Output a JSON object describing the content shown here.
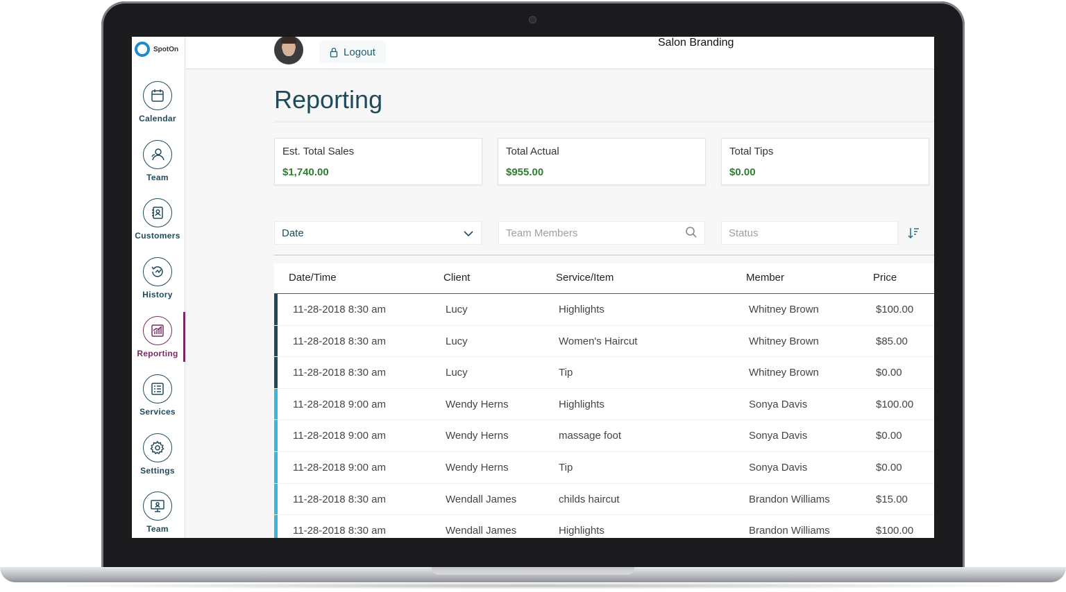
{
  "app": {
    "logo_text": "SpotOn",
    "brand": "Salon Branding",
    "logout_label": "Logout"
  },
  "sidebar": {
    "items": [
      {
        "label": "Calendar",
        "icon": "calendar-icon"
      },
      {
        "label": "Team",
        "icon": "team-icon"
      },
      {
        "label": "Customers",
        "icon": "customers-icon"
      },
      {
        "label": "History",
        "icon": "history-icon"
      },
      {
        "label": "Reporting",
        "icon": "reporting-icon",
        "active": true
      },
      {
        "label": "Services",
        "icon": "services-icon"
      },
      {
        "label": "Settings",
        "icon": "gear-icon"
      },
      {
        "label": "Team",
        "icon": "monitor-icon"
      }
    ]
  },
  "page": {
    "title": "Reporting"
  },
  "cards": [
    {
      "label": "Est. Total Sales",
      "value": "$1,740.00"
    },
    {
      "label": "Total Actual",
      "value": "$955.00"
    },
    {
      "label": "Total Tips",
      "value": "$0.00"
    }
  ],
  "filters": {
    "date_value": "Date",
    "team_placeholder": "Team Members",
    "status_placeholder": "Status"
  },
  "table": {
    "columns": [
      "Date/Time",
      "Client",
      "Service/Item",
      "Member",
      "Price"
    ],
    "rows": [
      {
        "datetime": "11-28-2018 8:30 am",
        "client": "Lucy",
        "service": "Highlights",
        "member": "Whitney Brown",
        "price": "$100.00",
        "accent": "#1f4a5a"
      },
      {
        "datetime": "11-28-2018 8:30 am",
        "client": "Lucy",
        "service": "Women's Haircut",
        "member": "Whitney Brown",
        "price": "$85.00",
        "accent": "#1f4a5a"
      },
      {
        "datetime": "11-28-2018 8:30 am",
        "client": "Lucy",
        "service": "Tip",
        "member": "Whitney Brown",
        "price": "$0.00",
        "accent": "#1f4a5a"
      },
      {
        "datetime": "11-28-2018 9:00 am",
        "client": "Wendy Herns",
        "service": "Highlights",
        "member": "Sonya Davis",
        "price": "$100.00",
        "accent": "#3bb8d8"
      },
      {
        "datetime": "11-28-2018 9:00 am",
        "client": "Wendy Herns",
        "service": "massage foot",
        "member": "Sonya Davis",
        "price": "$0.00",
        "accent": "#3bb8d8"
      },
      {
        "datetime": "11-28-2018 9:00 am",
        "client": "Wendy Herns",
        "service": "Tip",
        "member": "Sonya Davis",
        "price": "$0.00",
        "accent": "#3bb8d8"
      },
      {
        "datetime": "11-28-2018 8:30 am",
        "client": "Wendall James",
        "service": "childs haircut",
        "member": "Brandon Williams",
        "price": "$15.00",
        "accent": "#3bb8d8"
      },
      {
        "datetime": "11-28-2018 8:30 am",
        "client": "Wendall James",
        "service": "Highlights",
        "member": "Brandon Williams",
        "price": "$100.00",
        "accent": "#3bb8d8"
      }
    ]
  },
  "colors": {
    "primary": "#1f4a5a",
    "active": "#7a2a63",
    "money": "#2e7d32",
    "logo": "#1c8bc9"
  }
}
